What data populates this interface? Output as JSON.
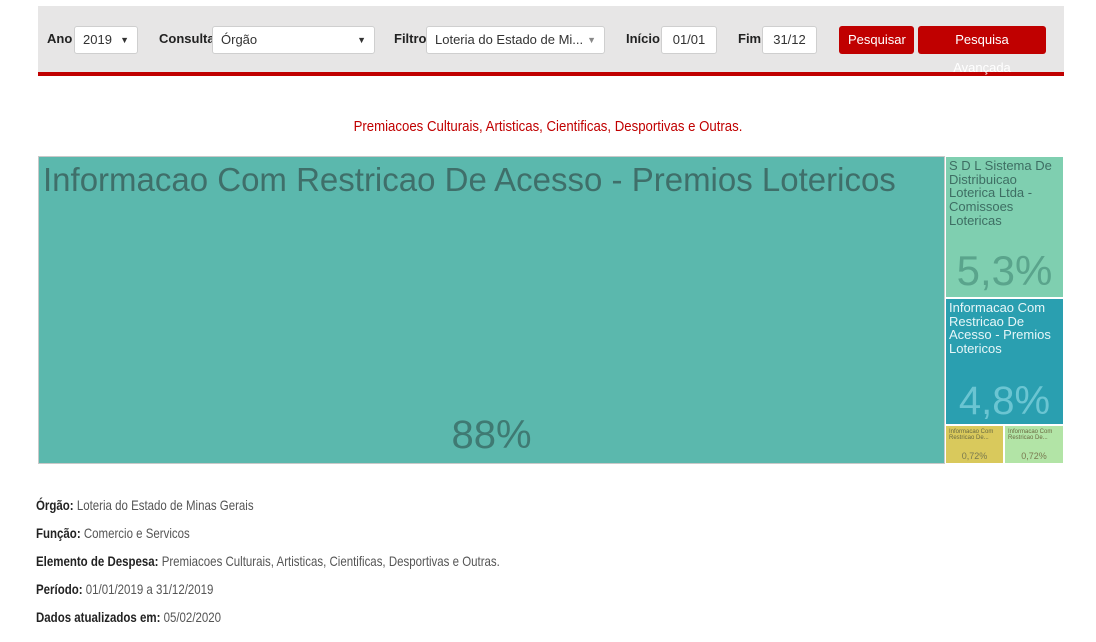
{
  "filters": {
    "year_label": "Ano",
    "year_value": "2019",
    "query_label": "Consulta",
    "query_value": "Órgão",
    "filter_label": "Filtro",
    "filter_value": "Loteria do Estado de Mi...",
    "start_label": "Início",
    "start_value": "01/01",
    "end_label": "Fim",
    "end_value": "31/12",
    "search_button": "Pesquisar",
    "advanced_button": "Pesquisa Avançada"
  },
  "chart_data": {
    "type": "treemap",
    "title": "Premiacoes Culturais, Artisticas, Cientificas, Desportivas e Outras.",
    "items": [
      {
        "name": "Informacao Com Restricao De Acesso - Premios Lotericos",
        "value": 88,
        "label": "88%",
        "color": "#5bb8ad"
      },
      {
        "name": "S D L Sistema De Distribuicao Loterica Ltda - Comissoes Lotericas",
        "value": 5.3,
        "label": "5,3%",
        "color": "#7fcfb0"
      },
      {
        "name": "Informacao Com Restricao De Acesso - Premios Lotericos",
        "value": 4.8,
        "label": "4,8%",
        "color": "#2a9fb0"
      },
      {
        "name": "Informacao Com Restricao De...",
        "value": 0.72,
        "label": "0,72%",
        "color": "#d9c95c"
      },
      {
        "name": "Informacao Com Restricao De...",
        "value": 0.72,
        "label": "0,72%",
        "color": "#b2e4a6"
      }
    ]
  },
  "info": {
    "orgao_label": "Órgão:",
    "orgao_value": "Loteria do Estado de Minas Gerais",
    "funcao_label": "Função:",
    "funcao_value": "Comercio e Servicos",
    "elemento_label": "Elemento de Despesa:",
    "elemento_value": "Premiacoes Culturais, Artisticas, Cientificas, Desportivas e Outras.",
    "periodo_label": "Período:",
    "periodo_value": "01/01/2019 a 31/12/2019",
    "atualizados_label": "Dados atualizados em:",
    "atualizados_value": "05/02/2020"
  },
  "colors": {
    "accent": "#c00000",
    "filterbar": "#e7e6e6"
  }
}
